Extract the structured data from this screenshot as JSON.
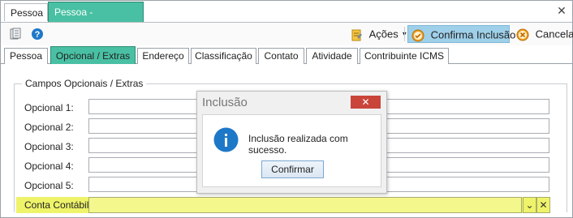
{
  "doc_tabs": [
    {
      "label": "Pessoa"
    },
    {
      "label": "Pessoa - [Inclusão]"
    }
  ],
  "toolbar": {
    "acoes_label": "Ações",
    "confirma_label": "Confirma Inclusão",
    "cancela_label": "Cancela"
  },
  "page_tabs": [
    {
      "label": "Pessoa"
    },
    {
      "label": "Opcional / Extras"
    },
    {
      "label": "Endereço"
    },
    {
      "label": "Classificação"
    },
    {
      "label": "Contato"
    },
    {
      "label": "Atividade"
    },
    {
      "label": "Contribuinte ICMS"
    }
  ],
  "active_tab": "Opcional / Extras",
  "group": {
    "title": "Campos Opcionais / Extras",
    "fields": [
      {
        "label": "Opcional 1:",
        "value": ""
      },
      {
        "label": "Opcional 2:",
        "value": ""
      },
      {
        "label": "Opcional 3:",
        "value": ""
      },
      {
        "label": "Opcional 4:",
        "value": ""
      },
      {
        "label": "Opcional 5:",
        "value": ""
      }
    ],
    "conta_label": "Conta Contábil:",
    "conta_value": ""
  },
  "dialog": {
    "title": "Inclusão",
    "message": "Inclusão realizada com sucesso.",
    "confirm_label": "Confirmar"
  },
  "colors": {
    "active_tab": "#49c0a3",
    "confirm_button": "#9fd0ea",
    "conta_highlight": "#eef36a",
    "dialog_close": "#c9453a",
    "info_icon": "#1e78c8"
  }
}
